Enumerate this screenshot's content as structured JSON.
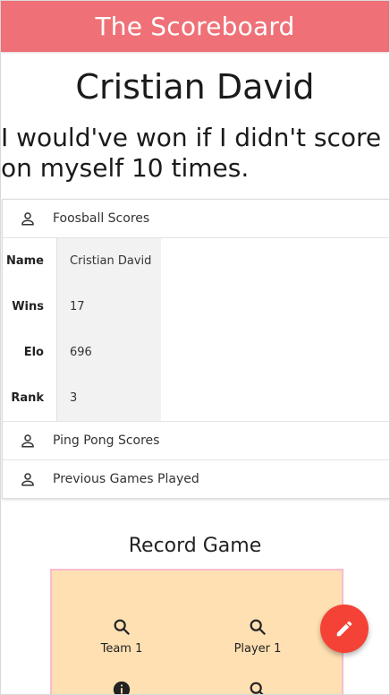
{
  "app": {
    "title": "The Scoreboard",
    "accent_color": "#ef7177"
  },
  "profile": {
    "name": "Cristian David",
    "quote": "I would've won if I didn't score on myself 10 times."
  },
  "sections": [
    {
      "label": "Foosball Scores",
      "icon": "person-icon",
      "expanded": true,
      "stats": [
        {
          "key": "Name",
          "value": "Cristian David"
        },
        {
          "key": "Wins",
          "value": "17"
        },
        {
          "key": "Elo",
          "value": "696"
        },
        {
          "key": "Rank",
          "value": "3"
        }
      ]
    },
    {
      "label": "Ping Pong Scores",
      "icon": "person-icon",
      "expanded": false
    },
    {
      "label": "Previous Games Played",
      "icon": "person-icon",
      "expanded": false
    }
  ],
  "record_game": {
    "title": "Record Game",
    "panel_color": "#ffe0b2",
    "fields": [
      {
        "label": "Team 1",
        "icon": "search-icon"
      },
      {
        "label": "Player 1",
        "icon": "search-icon"
      }
    ],
    "row2_icons": [
      "info-icon",
      "search-icon"
    ]
  },
  "fab": {
    "icon": "pencil-icon",
    "color": "#f44336"
  }
}
